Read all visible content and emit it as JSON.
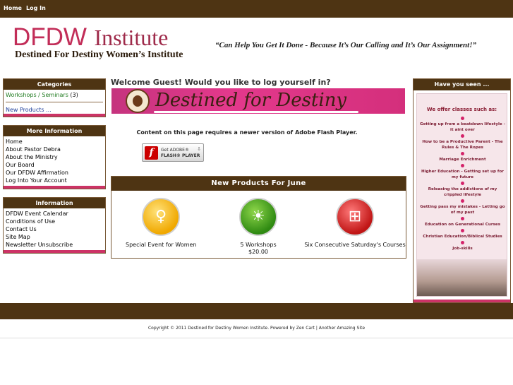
{
  "topnav": {
    "home": "Home",
    "login": "Log In"
  },
  "header": {
    "logo_dfdw": "DFDW",
    "logo_institute": "Institute",
    "logo_subtitle": "Destined For Destiny Women’s Institute",
    "tagline": "“Can Help You Get It Done - Because It’s Our Calling and It’s Our Assignment!”"
  },
  "categories": {
    "title": "Categories",
    "workshops_label": "Workshops / Seminars",
    "workshops_count": "(3)",
    "new_products": "New Products ..."
  },
  "more_info": {
    "title": "More Information",
    "items": [
      "Home",
      "About Pastor Debra",
      "About the Ministry",
      "Our Board",
      "Our DFDW Affirmation",
      "Log Into Your Account"
    ]
  },
  "information": {
    "title": "Information",
    "items": [
      "DFDW Event Calendar",
      "Conditions of Use",
      "Contact Us",
      "Site Map",
      "Newsletter Unsubscribe"
    ]
  },
  "main": {
    "welcome": "Welcome Guest! Would you like to log yourself in?",
    "banner_text": "Destined for Destiny",
    "flash_message": "Content on this page requires a newer version of Adobe Flash Player.",
    "flash_button_line1": "Get ADOBE®",
    "flash_button_line2": "FLASH® PLAYER",
    "new_products_title": "New Products For June",
    "products": [
      {
        "name": "Special Event for Women",
        "price": ""
      },
      {
        "name": "5 Workshops",
        "price": "$20.00"
      },
      {
        "name": "Six Consecutive Saturday's Courses",
        "price": ""
      }
    ]
  },
  "have_you_seen": {
    "title": "Have you seen ...",
    "panel_title": "We offer classes such as:",
    "classes": [
      "Getting up from a beatdown lifestyle - it aint over",
      "How to be a Productive Parent - The Rules & The Ropes",
      "Marriage Enrichment",
      "Higher Education - Getting set up for my future",
      "Releasing the addictions of my crippled lifestyle",
      "Getting pass my mistakes - Letting go of my past",
      "Education on Generational Curses",
      "Christian Education/Biblical Studies",
      "Job-skills"
    ]
  },
  "footer": {
    "copyright": "Copyright © 2011 Destined for Destiny Women Institute. Powered by Zen Cart | Another Amazing Site"
  },
  "colors": {
    "brown": "#4e3413",
    "pink": "#cc3366",
    "green_link": "#1e7a1e",
    "blue_link": "#1f3f9a"
  }
}
